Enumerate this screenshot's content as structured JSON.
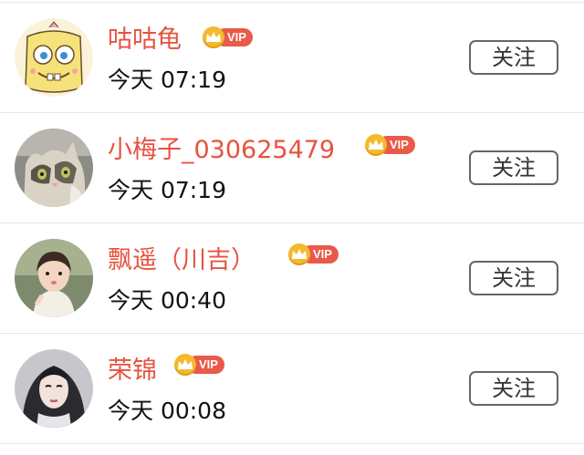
{
  "users": [
    {
      "name": "咕咕龟",
      "vip_label": "VIP",
      "time": "今天 07:19",
      "follow_label": "关注",
      "avatar": "spongebob-avatar-icon"
    },
    {
      "name": "小梅子_030625479",
      "vip_label": "VIP",
      "time": "今天 07:19",
      "follow_label": "关注",
      "avatar": "kitten-avatar-icon"
    },
    {
      "name": "飘遥（川吉）",
      "vip_label": "VIP",
      "time": "今天 00:40",
      "follow_label": "关注",
      "avatar": "girl-avatar-icon"
    },
    {
      "name": "荣锦",
      "vip_label": "VIP",
      "time": "今天 00:08",
      "follow_label": "关注",
      "avatar": "woman-avatar-icon"
    }
  ],
  "colors": {
    "name": "#e5533f",
    "vip_pill": "#e95a4a",
    "vip_crown": "#f5b92c",
    "divider": "#e6e6e6",
    "button_border": "#666666"
  }
}
